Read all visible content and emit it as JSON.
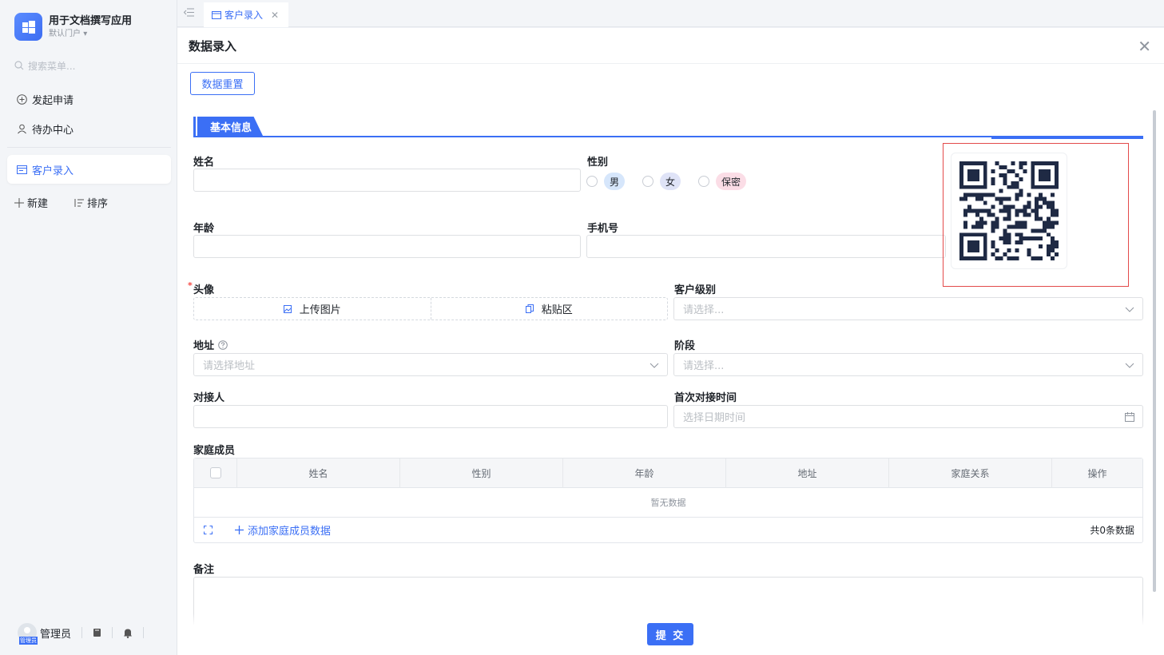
{
  "app": {
    "name": "用于文档撰写应用",
    "portal": "默认门户"
  },
  "sidebar": {
    "search_placeholder": "搜索菜单...",
    "items": [
      {
        "label": "发起申请"
      },
      {
        "label": "待办中心"
      },
      {
        "label": "客户录入"
      }
    ],
    "actions": {
      "new": "新建",
      "sort": "排序"
    },
    "user": {
      "name": "管理员",
      "avatar_caption": "管理员"
    }
  },
  "tabs": [
    {
      "label": "客户录入"
    }
  ],
  "panel": {
    "title": "数据录入",
    "reset": "数据重置",
    "section": "基本信息",
    "fields": {
      "name": "姓名",
      "gender": "性别",
      "age": "年龄",
      "phone": "手机号",
      "avatar": "头像",
      "level": "客户级别",
      "address": "地址",
      "stage": "阶段",
      "contact": "对接人",
      "first_time": "首次对接时间",
      "family": "家庭成员",
      "remark": "备注"
    },
    "gender_options": [
      {
        "label": "男",
        "color": "#d6e6fb"
      },
      {
        "label": "女",
        "color": "#dfe3f7"
      },
      {
        "label": "保密",
        "color": "#fbdde6"
      }
    ],
    "required_mark": "*",
    "upload": {
      "image": "上传图片",
      "paste": "粘贴区"
    },
    "placeholders": {
      "select": "请选择...",
      "address": "请选择地址",
      "datetime": "选择日期时间"
    },
    "table": {
      "columns": [
        "姓名",
        "性别",
        "年龄",
        "地址",
        "家庭关系",
        "操作"
      ],
      "empty": "暂无数据",
      "add": "添加家庭成员数据",
      "total": "共0条数据"
    },
    "submit": "提 交"
  },
  "colors": {
    "accent": "#3b6ff5",
    "highlight_box": "#e34a4a"
  }
}
